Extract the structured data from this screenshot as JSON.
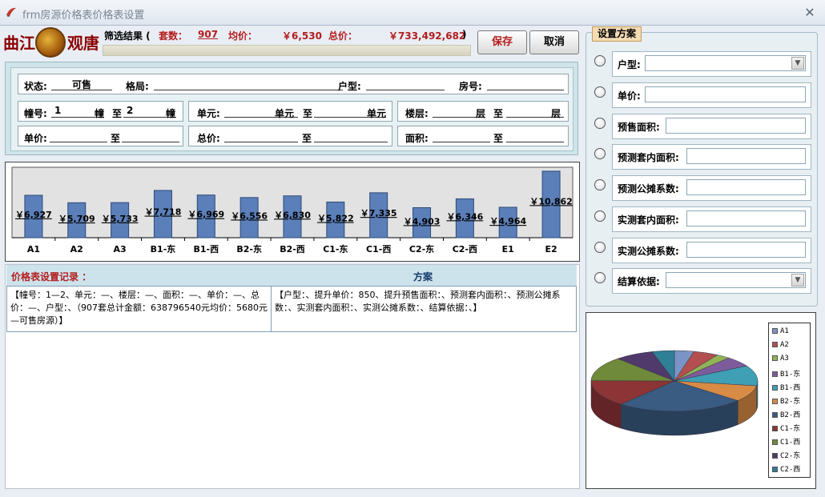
{
  "window": {
    "title": "frm房源价格表价格表设置"
  },
  "logo": {
    "left": "曲江",
    "right": "观唐"
  },
  "summary": {
    "prefix": "筛选结果 (",
    "count_label": "套数：",
    "count_value": "907",
    "avg_label": "均价：",
    "avg_value": "￥6,530",
    "total_label": "总价：",
    "total_value": "￥733,492,682",
    "suffix": ")"
  },
  "buttons": {
    "save": "保存",
    "cancel": "取消"
  },
  "filter": {
    "status_label": "状态:",
    "status_value": "可售",
    "layout_label": "格局:",
    "unit_type_label": "户型:",
    "room_label": "房号:",
    "building_label": "幢号:",
    "building_from": "1",
    "building_unit": "幢",
    "to": "至",
    "building_to": "2",
    "unit_label": "单元:",
    "unit_unit": "单元",
    "floor_label": "楼层:",
    "floor_unit": "层",
    "price_label": "单价:",
    "total_label": "总价:",
    "area_label": "面积:"
  },
  "chart_data": [
    {
      "type": "bar",
      "categories": [
        "A1",
        "A2",
        "A3",
        "B1-东",
        "B1-西",
        "B2-东",
        "B2-西",
        "C1-东",
        "C1-西",
        "C2-东",
        "C2-西",
        "E1",
        "E2"
      ],
      "values": [
        6927,
        5709,
        5733,
        7718,
        6969,
        6556,
        6830,
        5822,
        7335,
        4903,
        6346,
        4964,
        10862
      ],
      "labels": [
        "￥6,927",
        "￥5,709",
        "￥5,733",
        "￥7,718",
        "￥6,969",
        "￥6,556",
        "￥6,830",
        "￥5,822",
        "￥7,335",
        "￥4,903",
        "￥6,346",
        "￥4,964",
        "￥10,862"
      ],
      "ylim": [
        0,
        11500
      ],
      "grid": false,
      "bar_color": "#5b7fb8"
    },
    {
      "type": "pie",
      "labels": [
        "A1",
        "A2",
        "A3",
        "B1-东",
        "B1-西",
        "B2-东",
        "B2-西",
        "C1-东",
        "C1-西",
        "C2-东",
        "C2-西"
      ],
      "values": [
        3.5,
        4.5,
        2.5,
        5,
        10,
        8,
        23,
        13,
        12,
        7,
        4
      ],
      "colors": [
        "#7b94c6",
        "#b34f4f",
        "#91b356",
        "#7e5c9c",
        "#3f9fb4",
        "#d88b45",
        "#3a5b82",
        "#8c3436",
        "#6f8a3a",
        "#503a6b",
        "#2f7f96"
      ],
      "legend": "right",
      "style": "3d"
    }
  ],
  "records": {
    "title": "价格表设置记录 ：",
    "fangan": "方案",
    "left_text": "【幢号：1—2、单元：—、楼层：—、面积：—、单价：—、总价：—、户型：、（907套总计金额：638796540元均价：5680元—可售房源）】",
    "right_text": "【户型：、提升单价：850、提升预售面积：、预测套内面积：、预测公摊系数：、实测套内面积：、实测公摊系数：、结算依据：、】"
  },
  "settings": {
    "title": "设置方案",
    "items": [
      {
        "label": "户型:"
      },
      {
        "label": "单价:"
      },
      {
        "label": "预售面积:"
      },
      {
        "label": "预测套内面积:"
      },
      {
        "label": "预测公摊系数:"
      },
      {
        "label": "实测套内面积:"
      },
      {
        "label": "实测公摊系数:"
      },
      {
        "label": "结算依据:"
      }
    ]
  }
}
